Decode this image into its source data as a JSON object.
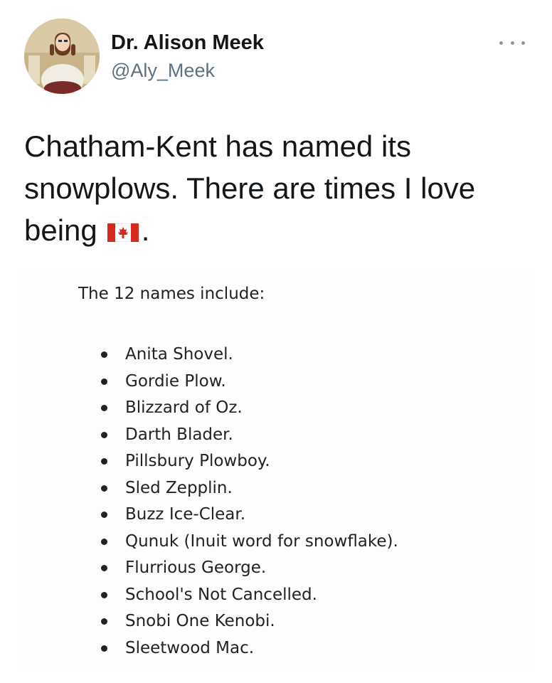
{
  "tweet": {
    "author_name": "Dr. Alison Meek",
    "handle": "@Aly_Meek",
    "text_line1": "Chatham-Kent has named its",
    "text_line2": "snowplows. There are times I love",
    "text_line3_before_flag": "being",
    "text_line3_after_flag": ".",
    "flag_icon": "canada-flag-icon",
    "more_icon": "more-options-icon"
  },
  "embedded_image": {
    "intro": "The 12 names include:",
    "names": [
      "Anita Shovel.",
      "Gordie Plow.",
      "Blizzard of Oz.",
      "Darth Blader.",
      "Pillsbury Plowboy.",
      "Sled Zepplin.",
      "Buzz Ice-Clear.",
      "Qunuk (Inuit word for snowflake).",
      "Flurrious George.",
      "School's Not Cancelled.",
      "Snobi One Kenobi.",
      "Sleetwood Mac."
    ]
  },
  "colors": {
    "text": "#14171a",
    "secondary": "#5b7083",
    "flag_red": "#d52b1e"
  }
}
